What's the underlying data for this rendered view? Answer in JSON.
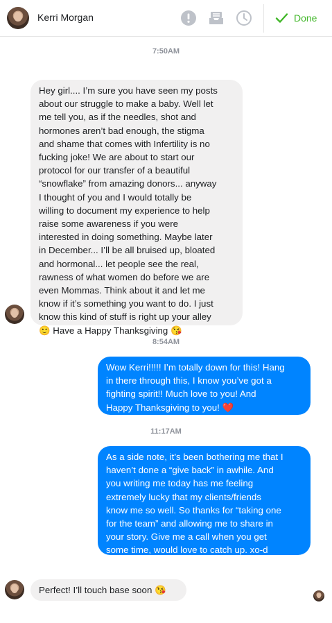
{
  "header": {
    "contact_name": "Kerri Morgan",
    "done_label": "Done",
    "icons": [
      "avatar",
      "alert-icon",
      "archive-icon",
      "clock-icon",
      "checkmark-icon"
    ],
    "accent_color": "#42b72a"
  },
  "conversation": {
    "timestamps": [
      "7:50AM",
      "8:54AM",
      "11:17AM"
    ],
    "messages": [
      {
        "sender": "contact",
        "text": "Hey girl.... I’m sure you have seen my posts\nabout our struggle to make a baby. Well let\nme tell you, as if the needles, shot and\nhormones aren’t bad enough, the stigma\nand shame that comes with Infertility is no\nfucking joke! We are about to start our\nprotocol for our transfer of a beautiful\n“snowflake” from amazing donors... anyway\nI thought of you and I would totally be\nwilling to document my experience to help\nraise some awareness if you were\ninterested in doing something. Maybe later\nin December... I’ll be all bruised up, bloated\nand hormonal... let people see the real,\nrawness of what women do before we are\neven Mommas. Think about it and let me\nknow if it’s something you want to do. I just\nknow this kind of stuff is right up your alley\n🙂 Have a Happy Thanksgiving 😘"
      },
      {
        "sender": "me",
        "text": "Wow Kerri!!!!! I’m totally down for this! Hang\nin there through this, I know you’ve got a\nfighting spirit!! Much love to you! And\nHappy Thanksgiving to you! ❤️"
      },
      {
        "sender": "me",
        "text": "As a side note, it’s been bothering me that I\nhaven’t done a “give back” in awhile. And\nyou writing me today has me feeling\nextremely lucky that my clients/friends\nknow me so well. So thanks for “taking one\nfor the team” and allowing me to share in\nyour story. Give me a call when you get\nsome time, would love to catch up. xo-d"
      },
      {
        "sender": "contact",
        "text": "Perfect! I’ll touch base soon 😘"
      }
    ],
    "bubble_colors": {
      "incoming": "#f1f0f0",
      "outgoing": "#0084ff"
    }
  }
}
